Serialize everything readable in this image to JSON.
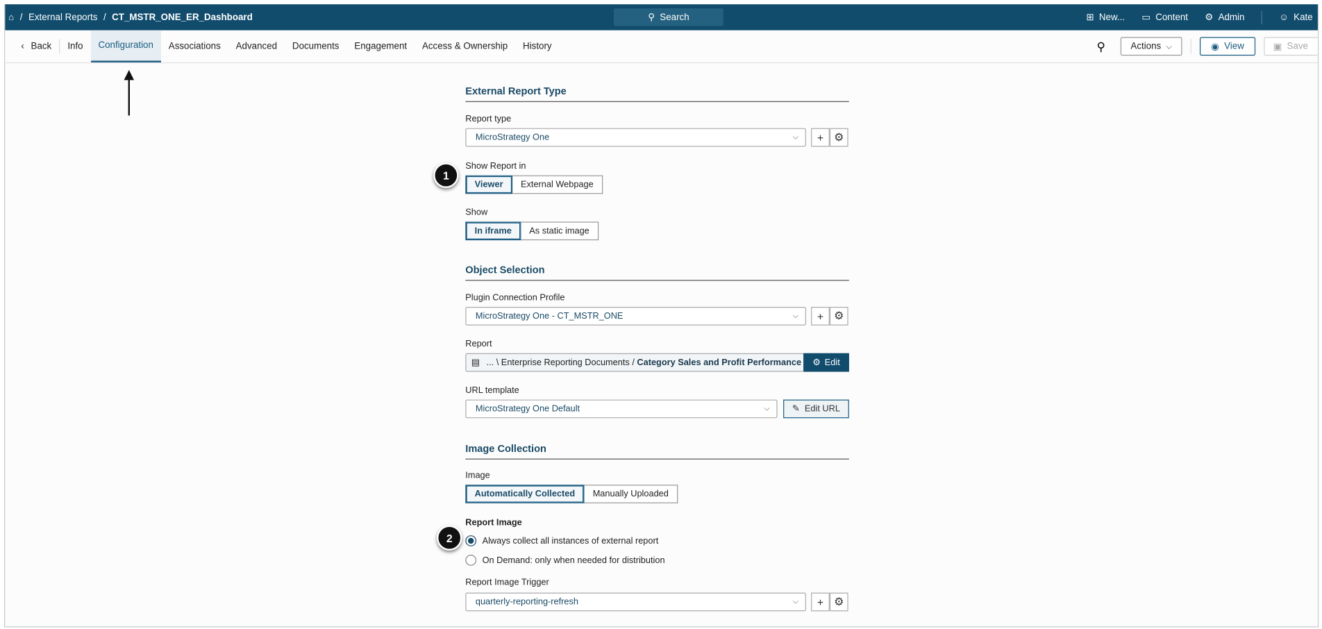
{
  "topbar": {
    "breadcrumb": [
      "External Reports",
      "CT_MSTR_ONE_ER_Dashboard"
    ],
    "search_label": "Search",
    "new_label": "New...",
    "content_label": "Content",
    "admin_label": "Admin",
    "user_label": "Kate"
  },
  "tabs": {
    "back": "Back",
    "items": [
      "Info",
      "Configuration",
      "Associations",
      "Advanced",
      "Documents",
      "Engagement",
      "Access & Ownership",
      "History"
    ],
    "active": "Configuration",
    "actions": "Actions",
    "view": "View",
    "save": "Save"
  },
  "ext_type": {
    "title": "External Report Type",
    "report_type_label": "Report type",
    "report_type_value": "MicroStrategy One",
    "show_in_label": "Show Report in",
    "show_in_options": [
      "Viewer",
      "External Webpage"
    ],
    "show_label": "Show",
    "show_options": [
      "In iframe",
      "As static image"
    ]
  },
  "object_sel": {
    "title": "Object Selection",
    "profile_label": "Plugin Connection Profile",
    "profile_value": "MicroStrategy One - CT_MSTR_ONE",
    "report_label": "Report",
    "report_path": "... \\ Enterprise Reporting Documents / ",
    "report_name": "Category Sales and Profit Performance",
    "edit_label": "Edit",
    "url_label": "URL template",
    "url_value": "MicroStrategy One Default",
    "edit_url_label": "Edit URL"
  },
  "image": {
    "title": "Image Collection",
    "image_label": "Image",
    "image_options": [
      "Automatically Collected",
      "Manually Uploaded"
    ],
    "report_image_label": "Report Image",
    "radio_options": [
      "Always collect all instances of external report",
      "On Demand: only when needed for distribution"
    ],
    "trigger_label": "Report Image Trigger",
    "trigger_value": "quarterly-reporting-refresh"
  },
  "badges": [
    "1",
    "2"
  ]
}
